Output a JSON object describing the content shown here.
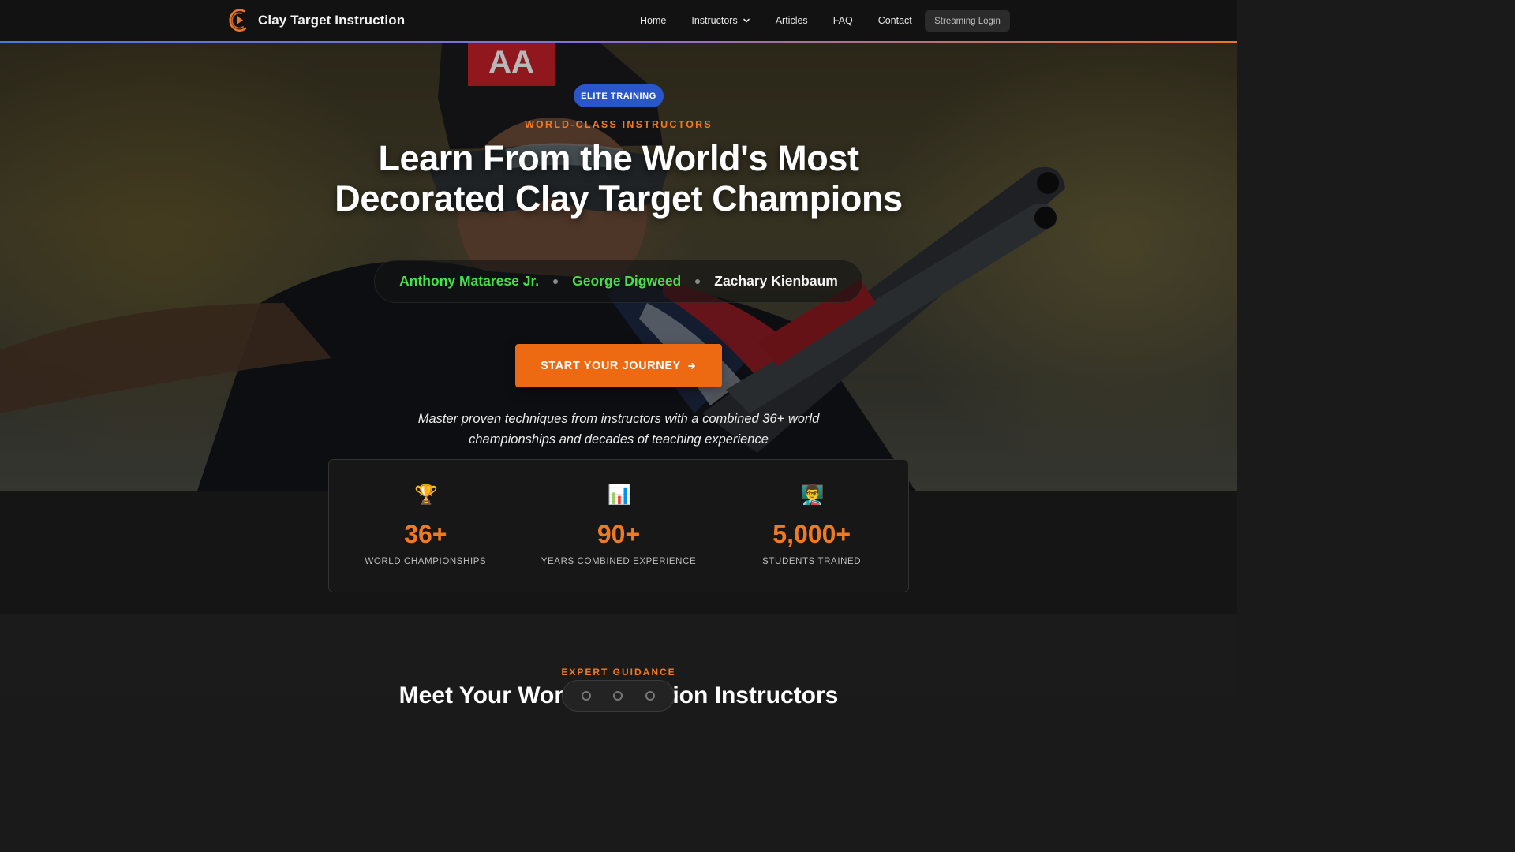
{
  "nav": {
    "brand": "Clay Target Instruction",
    "links": [
      {
        "label": "Home",
        "icon": null
      },
      {
        "label": "Instructors",
        "icon": "chevron-down-icon"
      },
      {
        "label": "Articles",
        "icon": null
      },
      {
        "label": "FAQ",
        "icon": null
      },
      {
        "label": "Contact",
        "icon": null
      }
    ],
    "login": "Streaming Login"
  },
  "hero": {
    "badge": "ELITE TRAINING",
    "eyebrow": "WORLD-CLASS INSTRUCTORS",
    "headline_line1": "Learn From the World's Most",
    "headline_line2": "Decorated Clay Target Champions",
    "names": [
      {
        "label": "Anthony Matarese Jr.",
        "color": "#47e04c"
      },
      {
        "label": "George Digweed",
        "color": "#47e04c"
      },
      {
        "label": "Zachary Kienbaum",
        "color": "#f4f4f4"
      }
    ],
    "cta": "START YOUR JOURNEY",
    "cta_icon": "arrow-right-icon",
    "tagline": "Master proven techniques from instructors with a combined 36+ world championships and decades of teaching experience"
  },
  "stats": [
    {
      "icon": "trophy-icon",
      "glyph": "🏆",
      "value": "36+",
      "label": "WORLD CHAMPIONSHIPS"
    },
    {
      "icon": "bar-chart-icon",
      "glyph": "📊",
      "value": "90+",
      "label": "YEARS COMBINED EXPERIENCE"
    },
    {
      "icon": "teacher-icon",
      "glyph": "👨‍🏫",
      "value": "5,000+",
      "label": "STUDENTS TRAINED"
    }
  ],
  "section2": {
    "eyebrow": "EXPERT GUIDANCE",
    "title": "Meet Your World-Champion Instructors"
  },
  "colors": {
    "accent": "#f07a22",
    "cta": "#ee6a12",
    "badge": "#2a56cc",
    "name_green": "#47e04c"
  }
}
